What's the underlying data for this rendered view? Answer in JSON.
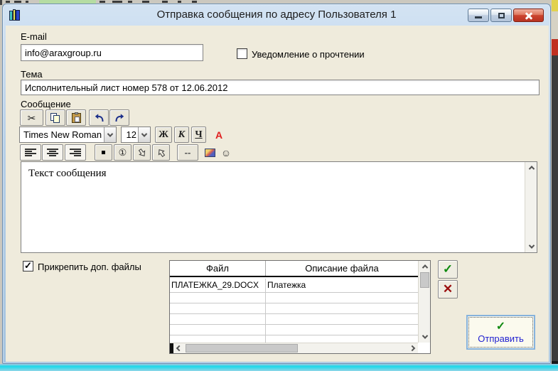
{
  "window": {
    "title": "Отправка сообщения по адресу Пользователя 1"
  },
  "email": {
    "label": "E-mail",
    "value": "info@araxgroup.ru"
  },
  "read_receipt": {
    "label": "Уведомление о прочтении",
    "checked": false
  },
  "subject": {
    "label": "Тема",
    "value": "Исполнительный лист номер 578 от 12.06.2012"
  },
  "message": {
    "label": "Сообщение",
    "text": "Текст сообщения"
  },
  "format_toolbar": {
    "font_family": "Times New Roman",
    "font_size": "12",
    "bold": "Ж",
    "italic": "К",
    "underline": "Ч",
    "font_color": "А",
    "font_color_hex": "#e02020"
  },
  "icons": {
    "cut": "✂",
    "bullet": "▪",
    "numbered_list": "①",
    "dashes": "--",
    "smiley": "☺",
    "confirm": "✓",
    "delete": "✕",
    "send_check": "✓"
  },
  "attachments": {
    "label": "Прикрепить доп. файлы",
    "checked": true,
    "table": {
      "headers": [
        "Файл",
        "Описание файла"
      ],
      "rows": [
        {
          "file": "ПЛАТЕЖКА_29.DOCX",
          "description": "Платежка"
        }
      ]
    }
  },
  "send_button": {
    "label": "Отправить"
  }
}
